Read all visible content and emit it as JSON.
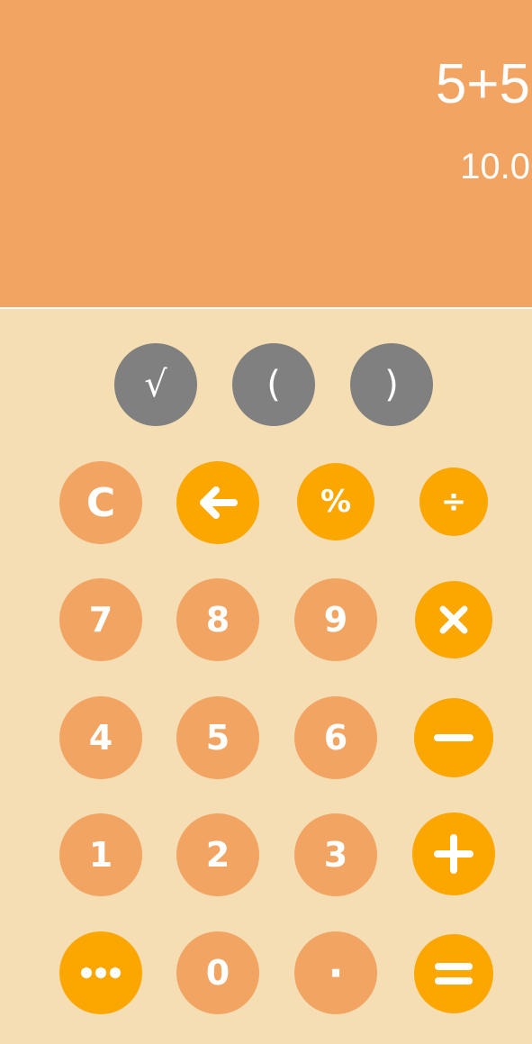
{
  "display": {
    "expression": "5+5",
    "result": "10.0"
  },
  "colors": {
    "display_background": "#f2a463",
    "keypad_background": "#f5deb4",
    "number_key": "#f2a463",
    "accent_key": "#fca600",
    "function_key": "#808080",
    "text": "#ffffff"
  },
  "keys": {
    "sqrt": "√",
    "open_paren": "(",
    "close_paren": ")",
    "clear": "C",
    "percent": "%",
    "divide": "÷",
    "seven": "7",
    "eight": "8",
    "nine": "9",
    "four": "4",
    "five": "5",
    "six": "6",
    "one": "1",
    "two": "2",
    "three": "3",
    "zero": "0",
    "decimal": "·"
  },
  "icons": {
    "backspace": "left-arrow-icon",
    "multiply": "multiply-icon",
    "minus": "minus-icon",
    "plus": "plus-icon",
    "more": "more-dots-icon",
    "equals": "equals-icon"
  }
}
